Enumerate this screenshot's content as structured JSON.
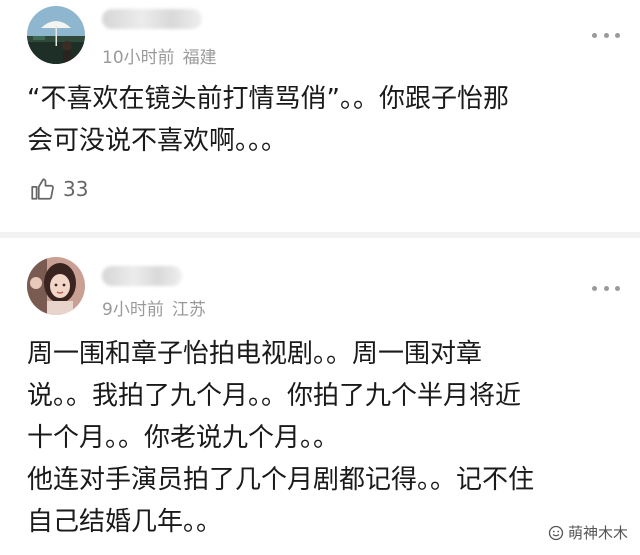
{
  "comments": [
    {
      "time": "10小时前",
      "location": "福建",
      "lines": [
        "“不喜欢在镜头前打情骂俏”。。你跟子怡那",
        "会可没说不喜欢啊。。。"
      ],
      "likes": "33",
      "avatar_icon": "beach-umbrella-avatar"
    },
    {
      "time": "9小时前",
      "location": "江苏",
      "lines": [
        "周一围和章子怡拍电视剧。。周一围对章",
        "说。。我拍了九个月。。你拍了九个半月将近",
        "十个月。。你老说九个月。。",
        "他连对手演员拍了几个月剧都记得。。记不住",
        "自己结婚几年。。"
      ],
      "avatar_icon": "girl-portrait-avatar"
    }
  ],
  "watermark": {
    "text": "萌神木木",
    "icon": "smile-icon"
  },
  "colors": {
    "meta": "#9a9a9a",
    "text": "#1a1a1a",
    "divider": "#f2f2f2"
  }
}
